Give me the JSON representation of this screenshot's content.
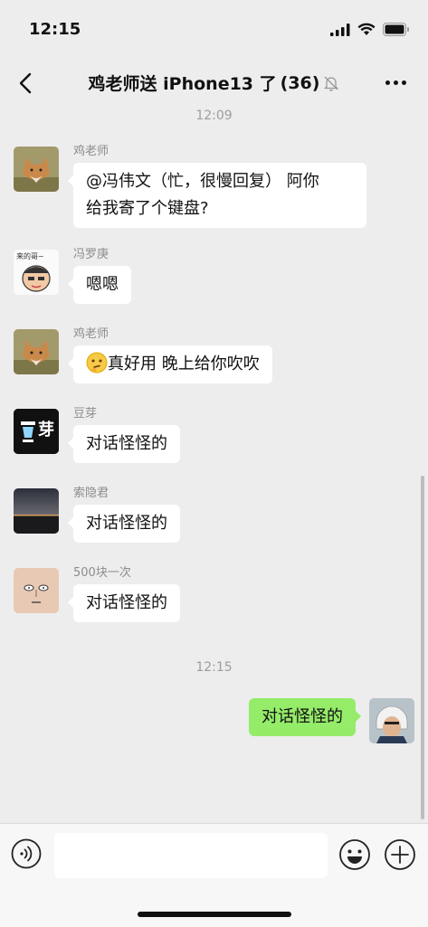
{
  "status_bar": {
    "time": "12:15"
  },
  "header": {
    "title": "鸡老师送 iPhone13 了",
    "member_count": "(36)"
  },
  "chat": {
    "timestamps": [
      "12:09",
      "12:15"
    ],
    "messages": [
      {
        "sender": "鸡老师",
        "text_line1": "@冯伟文（忙，很慢回复） 阿你",
        "text_line2": "给我寄了个键盘?",
        "avatar": "fox-avatar"
      },
      {
        "sender": "冯罗庚",
        "text": "嗯嗯",
        "avatar": "cartoon-face-avatar",
        "avatar_caption": "来的哥~"
      },
      {
        "sender": "鸡老师",
        "emoji": "thinking-face-emoji",
        "text": "真好用 晚上给你吹吹",
        "avatar": "fox-avatar"
      },
      {
        "sender": "豆芽",
        "text": "对话怪怪的",
        "avatar": "douya-logo-avatar",
        "avatar_text": "芽"
      },
      {
        "sender": "索隐君",
        "text": "对话怪怪的",
        "avatar": "sunset-landscape-avatar"
      },
      {
        "sender": "500块一次",
        "text": "对话怪怪的",
        "avatar": "bald-face-avatar"
      },
      {
        "sender": "me",
        "text": "对话怪怪的",
        "avatar": "helmet-person-avatar"
      }
    ]
  },
  "input_bar": {
    "placeholder": ""
  },
  "colors": {
    "background": "#ededed",
    "my_bubble": "#95ec69",
    "other_bubble": "#ffffff"
  }
}
